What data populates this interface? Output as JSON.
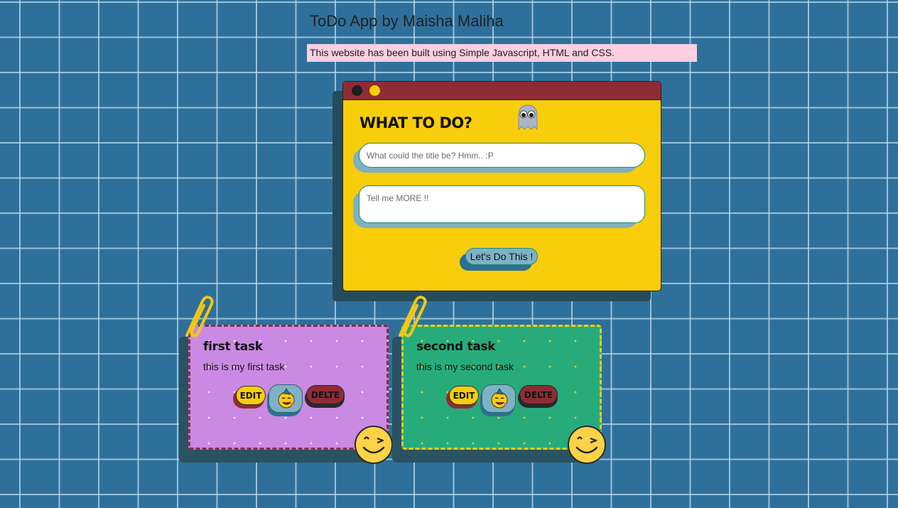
{
  "header": {
    "title": "ToDo App by Maisha Maliha",
    "banner": "This website has been built using Simple Javascript, HTML and CSS."
  },
  "form": {
    "heading": "WHAT TO DO?",
    "title_placeholder": "What could the title be? Hmm.. :P",
    "title_value": "",
    "description_placeholder": "Tell me MORE !!",
    "description_value": "",
    "submit_label": "Let's Do This !"
  },
  "tasks": [
    {
      "title": "first task",
      "description": "this is my first task",
      "edit_label": "EDIT",
      "delete_label": "DELTE",
      "color": "#ca89e2"
    },
    {
      "title": "second task",
      "description": "this is my second task",
      "edit_label": "EDIT",
      "delete_label": "DELTE",
      "color": "#28ab7b"
    }
  ],
  "icons": {
    "ghost": "ghost-icon",
    "paperclip": "paperclip-icon",
    "wink": "winking-face-icon",
    "party": "party-face-icon"
  },
  "colors": {
    "background": "#2f709a",
    "accent_yellow": "#f8cd0b",
    "accent_maroon": "#8e2c35",
    "banner_pink": "#fccfe3"
  }
}
